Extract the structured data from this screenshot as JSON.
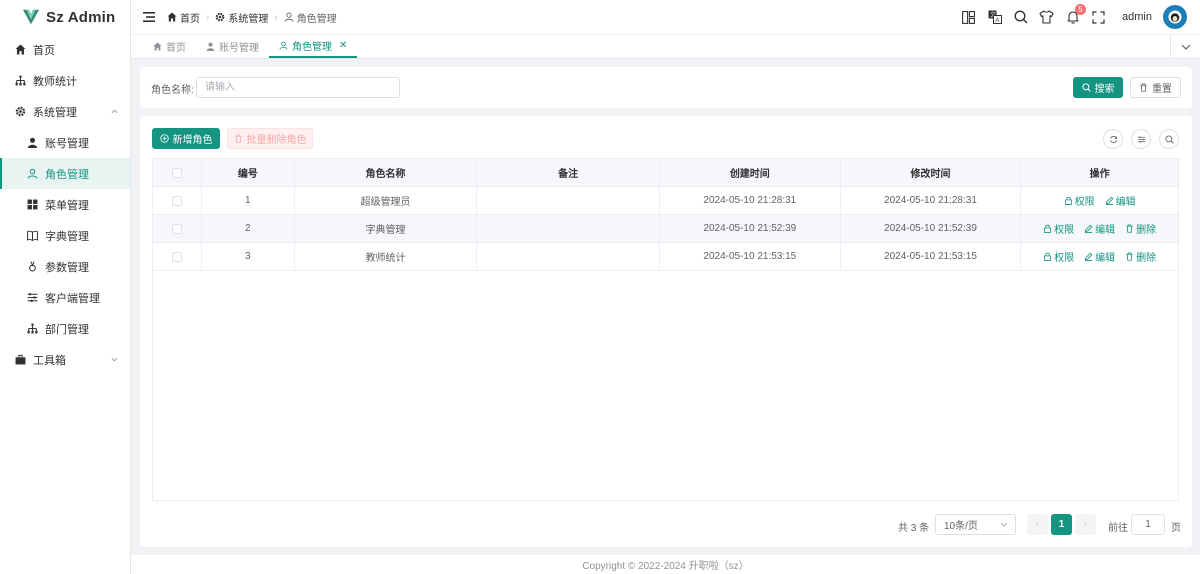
{
  "app": {
    "title": "Sz Admin"
  },
  "sidebar": {
    "items": [
      {
        "label": "首页",
        "icon": "home-icon"
      },
      {
        "label": "教师统计",
        "icon": "org-chart-icon"
      },
      {
        "label": "系统管理",
        "icon": "gear-icon",
        "expanded": true
      },
      {
        "label": "账号管理",
        "icon": "user-icon"
      },
      {
        "label": "角色管理",
        "icon": "user-outline-icon",
        "active": true
      },
      {
        "label": "菜单管理",
        "icon": "grid-icon"
      },
      {
        "label": "字典管理",
        "icon": "book-icon"
      },
      {
        "label": "参数管理",
        "icon": "param-icon"
      },
      {
        "label": "客户端管理",
        "icon": "sliders-icon"
      },
      {
        "label": "部门管理",
        "icon": "org-chart-icon"
      },
      {
        "label": "工具箱",
        "icon": "toolbox-icon",
        "expanded": false
      }
    ]
  },
  "header": {
    "breadcrumb": [
      "首页",
      "系统管理",
      "角色管理"
    ],
    "notification_count": "5",
    "username": "admin"
  },
  "tabs": [
    {
      "label": "首页"
    },
    {
      "label": "账号管理"
    },
    {
      "label": "角色管理",
      "active": true
    }
  ],
  "search": {
    "label": "角色名称:",
    "placeholder": "请输入",
    "value": "",
    "search_button": "搜索",
    "reset_button": "重置"
  },
  "toolbar": {
    "add_button": "新增角色",
    "batch_delete_button": "批量删除角色"
  },
  "table": {
    "columns": [
      "编号",
      "角色名称",
      "备注",
      "创建时间",
      "修改时间",
      "操作"
    ],
    "rows": [
      {
        "id": "1",
        "name": "超级管理员",
        "remark": "",
        "created": "2024-05-10 21:28:31",
        "updated": "2024-05-10 21:28:31",
        "actions": [
          "权限",
          "编辑"
        ]
      },
      {
        "id": "2",
        "name": "字典管理",
        "remark": "",
        "created": "2024-05-10 21:52:39",
        "updated": "2024-05-10 21:52:39",
        "actions": [
          "权限",
          "编辑",
          "删除"
        ]
      },
      {
        "id": "3",
        "name": "教师统计",
        "remark": "",
        "created": "2024-05-10 21:53:15",
        "updated": "2024-05-10 21:53:15",
        "actions": [
          "权限",
          "编辑",
          "删除"
        ]
      }
    ]
  },
  "pagination": {
    "total_text": "共 3 条",
    "page_size": "10条/页",
    "current_page": "1",
    "goto_label": "前往",
    "goto_value": "1",
    "page_unit": "页"
  },
  "footer": {
    "copyright": "Copyright © 2022-2024 升职啦（sz）"
  },
  "colors": {
    "accent": "#149481",
    "danger": "#f56c6c"
  }
}
